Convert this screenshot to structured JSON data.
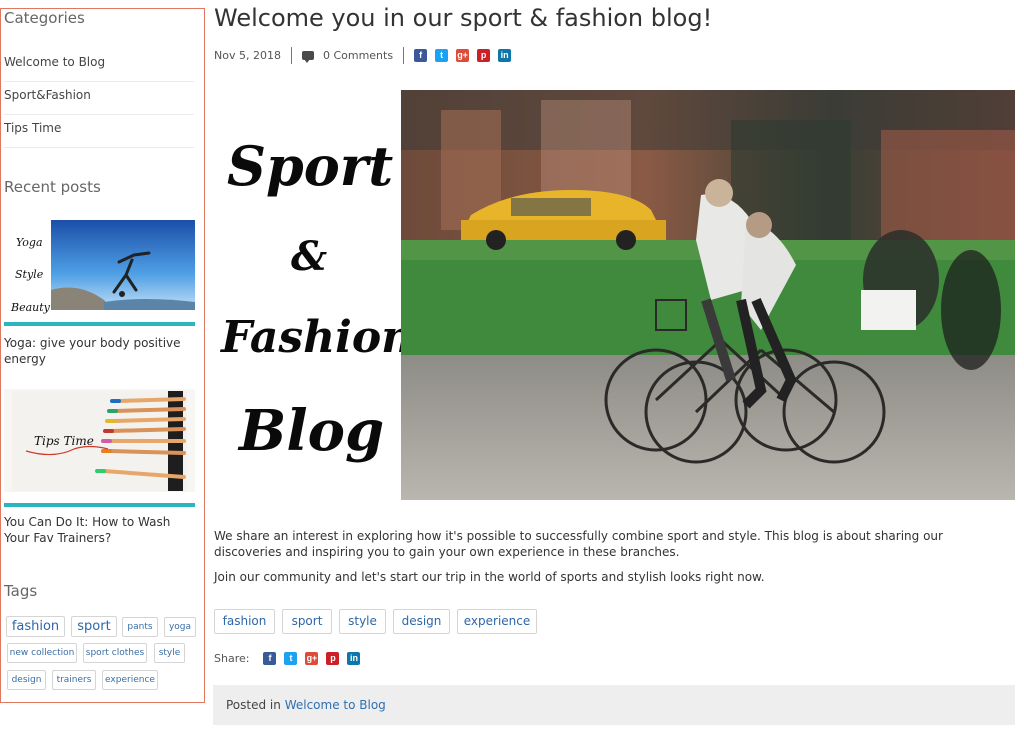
{
  "sidebar": {
    "categories_heading": "Categories",
    "categories": [
      "Welcome to Blog",
      "Sport&Fashion",
      "Tips Time"
    ],
    "recent_heading": "Recent posts",
    "recent_posts": [
      {
        "title": "Yoga: give your body positive energy",
        "thumb_words": [
          "Yoga",
          "Style",
          "Beauty"
        ]
      },
      {
        "title": "You Can Do It: How to Wash Your Fav Trainers?",
        "thumb_words": [
          "Tips Time"
        ]
      }
    ],
    "tags_heading": "Tags",
    "tags": [
      "fashion",
      "sport",
      "pants",
      "yoga",
      "new collection",
      "sport clothes",
      "style",
      "design",
      "trainers",
      "experience"
    ]
  },
  "post": {
    "title": "Welcome you in our sport & fashion blog!",
    "date": "Nov 5, 2018",
    "comments": "0 Comments",
    "hero_words": [
      "Sport",
      "&",
      "Fashion",
      "Blog"
    ],
    "paragraphs": [
      "We share an interest in exploring how it's possible to successfully combine sport and style. This blog is about sharing our discoveries and inspiring you to gain your own experience in these branches.",
      "Join our community and let's start our trip in the world of sports and stylish looks right now."
    ],
    "tags": [
      "fashion",
      "sport",
      "style",
      "design",
      "experience"
    ],
    "share_label": "Share:",
    "posted_in_label": "Posted in",
    "posted_in_category": "Welcome to Blog"
  },
  "social_icons": [
    {
      "name": "facebook-icon",
      "glyph": "f",
      "color": "#3a5998"
    },
    {
      "name": "twitter-icon",
      "glyph": "t",
      "color": "#1da1f2"
    },
    {
      "name": "google-plus-icon",
      "glyph": "g+",
      "color": "#dd4b39"
    },
    {
      "name": "pinterest-icon",
      "glyph": "p",
      "color": "#cb2027"
    },
    {
      "name": "linkedin-icon",
      "glyph": "in",
      "color": "#0e76a8"
    }
  ],
  "colors": {
    "accent_bar": "#2bb5be",
    "link": "#2e67a8",
    "sidebar_border": "#e07860"
  }
}
